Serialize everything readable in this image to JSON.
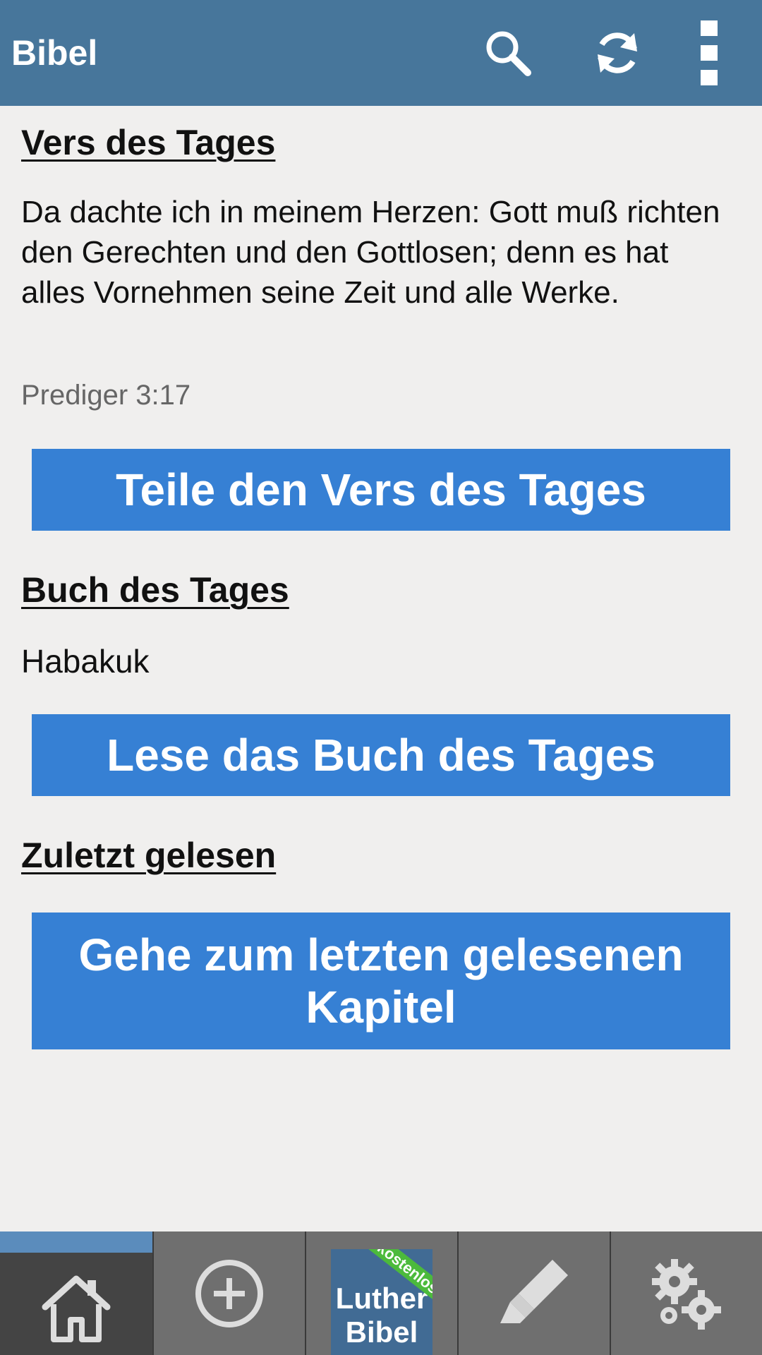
{
  "appbar": {
    "title": "Bibel",
    "actions": [
      "search-icon",
      "refresh-icon",
      "overflow-menu-icon"
    ],
    "bg": "#47769b"
  },
  "verse": {
    "heading": "Vers des Tages",
    "text": "Da dachte ich in meinem Herzen: Gott muß richten den Gerechten und den Gottlosen; denn es hat alles Vornehmen seine Zeit und alle Werke.",
    "reference": "Prediger 3:17",
    "share_button": "Teile den Vers des Tages"
  },
  "book": {
    "heading": "Buch des Tages",
    "name": "Habakuk",
    "read_button": "Lese das Buch des Tages"
  },
  "recent": {
    "heading": "Zuletzt gelesen",
    "button": "Gehe zum letzten gelesenen Kapitel"
  },
  "bottom_nav": {
    "items": [
      "home-icon",
      "add-circle-icon",
      "luther-bibel-logo",
      "highlighter-icon",
      "settings-gears-icon"
    ],
    "logo_ribbon": "kostenlos",
    "logo_line1": "Luther",
    "logo_line2": "Bibel",
    "active_index": 0
  },
  "colors": {
    "accent": "#3680d4",
    "background": "#f0efee"
  }
}
